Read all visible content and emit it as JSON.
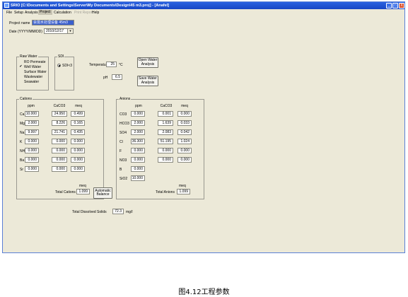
{
  "window": {
    "title": "SRIO [C:\\Documents and Settings\\Server\\My Documents\\Design\\45 m3.proj] - [Anafel]",
    "controls": [
      "_",
      "□",
      "X"
    ]
  },
  "menu": [
    "File",
    "Setup",
    "Analysis",
    "Project",
    "Calculation",
    "Print Report",
    "Help"
  ],
  "project": {
    "name_label": "Project name",
    "name_value": "会需水处理设备 45m3",
    "date_label": "Date (YYYY/MM/DD)",
    "date_value": "2010/12/17"
  },
  "raw_water": {
    "title": "Raw Water",
    "options": [
      "RO Permeate",
      "Well Water",
      "Surface Water",
      "Wastewater",
      "Seawater"
    ],
    "checked": "Well Water"
  },
  "sdi": {
    "title": "SDI",
    "option": "SDI<3",
    "checked": true
  },
  "temperature": {
    "label": "Temperature",
    "value": "25",
    "unit": "°C"
  },
  "ph": {
    "label": "pH",
    "value": "6.5"
  },
  "buttons": {
    "open": [
      "Open Water",
      "Analysis"
    ],
    "save": [
      "Save Water",
      "Analysis"
    ],
    "auto": [
      "Automatic",
      "Balance"
    ]
  },
  "cations": {
    "title": "Cations",
    "headers": [
      "ppm",
      "CaCO3",
      "meq"
    ],
    "rows": [
      {
        "ion": "Ca",
        "ppm": "10.000",
        "caco3": "24.950",
        "meq": "0.499"
      },
      {
        "ion": "Mg",
        "ppm": "2.000",
        "caco3": "8.226",
        "meq": "0.165"
      },
      {
        "ion": "Na",
        "ppm": "9.997",
        "caco3": "21.741",
        "meq": "0.435"
      },
      {
        "ion": "K",
        "ppm": "0.000",
        "caco3": "0.000",
        "meq": "0.000"
      },
      {
        "ion": "NH4",
        "ppm": "0.000",
        "caco3": "0.000",
        "meq": "0.000"
      },
      {
        "ion": "Ba",
        "ppm": "0.000",
        "caco3": "0.000",
        "meq": "0.000"
      },
      {
        "ion": "Sr",
        "ppm": "0.000",
        "caco3": "0.000",
        "meq": "0.000"
      }
    ],
    "total_meq_label": "meq",
    "total_label": "Total Cations",
    "total_value": "1.099"
  },
  "anions": {
    "title": "Anions",
    "headers": [
      "ppm",
      "CaCO3",
      "meq"
    ],
    "rows": [
      {
        "ion": "CO3",
        "ppm": "0.000",
        "caco3": "0.001",
        "meq": "0.000"
      },
      {
        "ion": "HCO3",
        "ppm": "2.000",
        "caco3": "1.639",
        "meq": "0.033"
      },
      {
        "ion": "SO4",
        "ppm": "2.000",
        "caco3": "2.083",
        "meq": "0.042"
      },
      {
        "ion": "Cl",
        "ppm": "36.300",
        "caco3": "51.195",
        "meq": "1.024"
      },
      {
        "ion": "F",
        "ppm": "0.000",
        "caco3": "0.000",
        "meq": "0.000"
      },
      {
        "ion": "NO3",
        "ppm": "0.000",
        "caco3": "0.000",
        "meq": "0.000"
      },
      {
        "ion": "B",
        "ppm": "0.000",
        "caco3": "",
        "meq": ""
      },
      {
        "ion": "SiO2",
        "ppm": "10.000",
        "caco3": "",
        "meq": ""
      }
    ],
    "total_meq_label": "meq",
    "total_label": "Total Anions",
    "total_value": "1.099"
  },
  "tds": {
    "label": "Total Dissolved Solids",
    "value": "72.3",
    "unit": "mg/l"
  },
  "caption": "图4.12工程参数"
}
